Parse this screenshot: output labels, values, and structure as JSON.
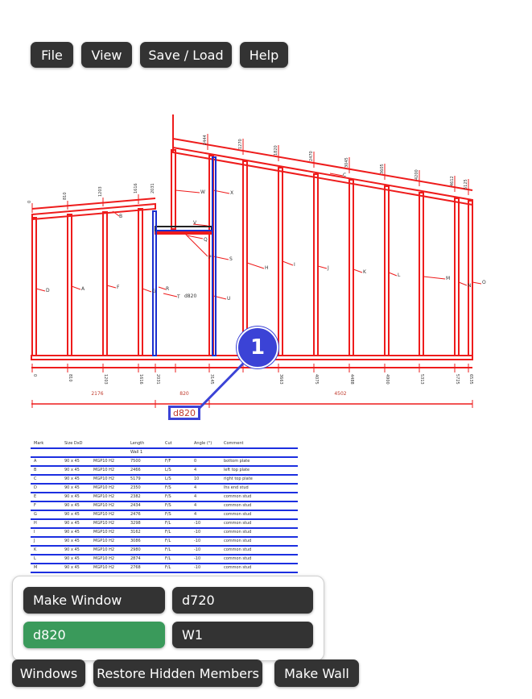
{
  "menu": {
    "file": "File",
    "view": "View",
    "save_load": "Save / Load",
    "help": "Help"
  },
  "drawing": {
    "stud_marks": [
      "D",
      "A",
      "F",
      "G",
      "R",
      "T",
      "W",
      "X",
      "V",
      "S",
      "U",
      "H",
      "I",
      "J",
      "K",
      "L",
      "M",
      "N",
      "O",
      "Q",
      "P",
      "E",
      "B",
      "C"
    ],
    "top_dims": [
      "0",
      "810",
      "1203",
      "1616",
      "2031",
      "2444",
      "1270",
      "1820",
      "2470",
      "3045",
      "3605",
      "4200",
      "4612",
      "5125"
    ],
    "bottom_dims": [
      "0",
      "810",
      "1203",
      "1616",
      "2031",
      "2444",
      "3145",
      "3663",
      "4075",
      "4488",
      "4900",
      "5313",
      "5725",
      "6138",
      "6535"
    ],
    "segment_dims": [
      "2176",
      "820",
      "4502"
    ],
    "opening_label": "d820",
    "highlight_label": "d820",
    "marker_number": "1"
  },
  "schedule": {
    "headers": [
      "Mark",
      "Size DxD",
      "",
      "Length",
      "Cut",
      "Angle (°)",
      "Comment"
    ],
    "wall_label": "Wall 1",
    "rows": [
      [
        "A",
        "90 x 45",
        "MGP10 H2",
        "7500",
        "F/F",
        "0",
        "bottom plate"
      ],
      [
        "B",
        "90 x 45",
        "MGP10 H2",
        "2466",
        "L/S",
        "4",
        "left top plate"
      ],
      [
        "C",
        "90 x 45",
        "MGP10 H2",
        "5179",
        "L/S",
        "10",
        "right top plate"
      ],
      [
        "D",
        "90 x 45",
        "MGP10 H2",
        "2350",
        "F/S",
        "4",
        "lhs end stud"
      ],
      [
        "E",
        "90 x 45",
        "MGP10 H2",
        "2382",
        "F/S",
        "4",
        "common stud"
      ],
      [
        "F",
        "90 x 45",
        "MGP10 H2",
        "2434",
        "F/S",
        "4",
        "common stud"
      ],
      [
        "G",
        "90 x 45",
        "MGP10 H2",
        "2476",
        "F/S",
        "4",
        "common stud"
      ],
      [
        "H",
        "90 x 45",
        "MGP10 H2",
        "3298",
        "F/L",
        "-10",
        "common stud"
      ],
      [
        "I",
        "90 x 45",
        "MGP10 H2",
        "3162",
        "F/L",
        "-10",
        "common stud"
      ],
      [
        "J",
        "90 x 45",
        "MGP10 H2",
        "3086",
        "F/L",
        "-10",
        "common stud"
      ],
      [
        "K",
        "90 x 45",
        "MGP10 H2",
        "2980",
        "F/L",
        "-10",
        "common stud"
      ],
      [
        "L",
        "90 x 45",
        "MGP10 H2",
        "2874",
        "F/L",
        "-10",
        "common stud"
      ],
      [
        "M",
        "90 x 45",
        "MGP10 H2",
        "2768",
        "F/L",
        "-10",
        "common stud"
      ]
    ]
  },
  "popup": {
    "make_window": "Make Window",
    "d720": "d720",
    "d820": "d820",
    "w1": "W1"
  },
  "bottom_bar": {
    "windows": "Windows",
    "restore": "Restore Hidden Members",
    "make_wall": "Make Wall"
  },
  "colors": {
    "button_bg": "#333333",
    "selected_bg": "#3a9a5b",
    "frame_red": "#ee1c1c",
    "door_blue": "#1c2fd0",
    "marker_blue": "#3b43d6"
  }
}
